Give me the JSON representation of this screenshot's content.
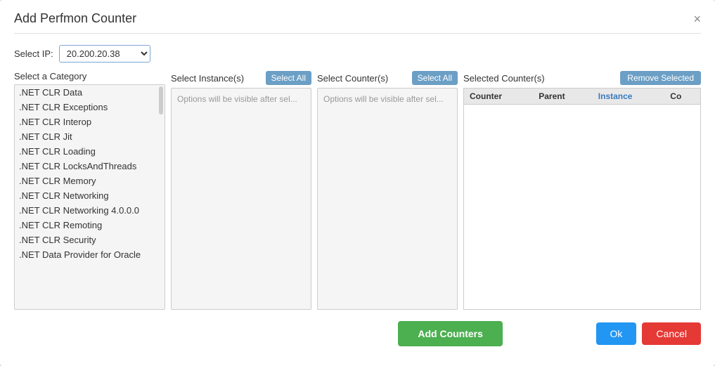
{
  "modal": {
    "title": "Add Perfmon Counter",
    "close_label": "×"
  },
  "select_ip": {
    "label": "Select IP:",
    "value": "20.200.20.38",
    "options": [
      "20.200.20.38"
    ]
  },
  "category": {
    "header": "Select a Category",
    "items": [
      ".NET CLR Data",
      ".NET CLR Exceptions",
      ".NET CLR Interop",
      ".NET CLR Jit",
      ".NET CLR Loading",
      ".NET CLR LocksAndThreads",
      ".NET CLR Memory",
      ".NET CLR Networking",
      ".NET CLR Networking 4.0.0.0",
      ".NET CLR Remoting",
      ".NET CLR Security",
      ".NET Data Provider for Oracle"
    ]
  },
  "instance": {
    "header": "Select Instance(s)",
    "select_all_label": "Select All",
    "placeholder": "Options will be visible after sel..."
  },
  "counter": {
    "header": "Select Counter(s)",
    "select_all_label": "Select All",
    "placeholder": "Options will be visible after sel..."
  },
  "selected_counters": {
    "header": "Selected Counter(s)",
    "remove_selected_label": "Remove Selected",
    "columns": [
      "Counter",
      "Parent",
      "Instance",
      "Co"
    ],
    "rows": []
  },
  "buttons": {
    "add_counters": "Add Counters",
    "ok": "Ok",
    "cancel": "Cancel"
  }
}
